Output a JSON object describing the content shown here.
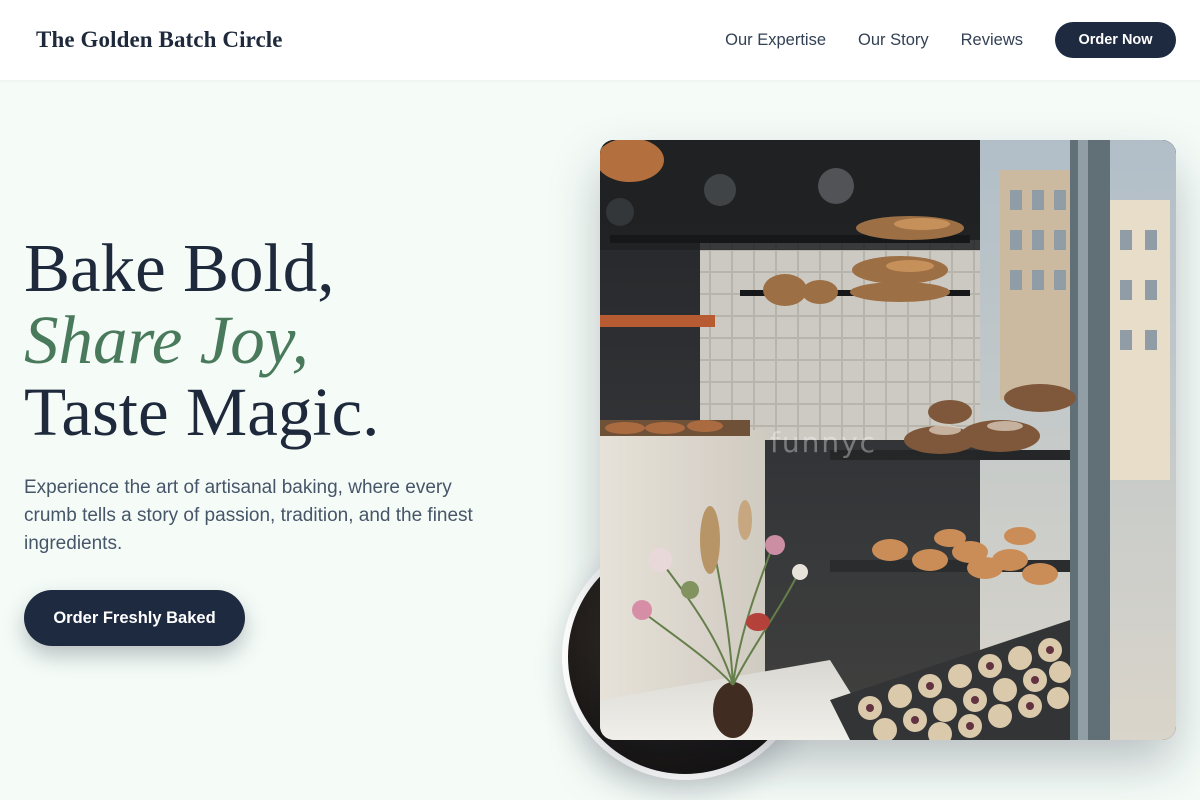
{
  "header": {
    "brand": "The Golden Batch Circle",
    "nav": [
      {
        "label": "Our Expertise"
      },
      {
        "label": "Our Story"
      },
      {
        "label": "Reviews"
      }
    ],
    "order_button": "Order Now"
  },
  "hero": {
    "title_line1": "Bake Bold,",
    "title_line2": "Share Joy,",
    "title_line3": "Taste Magic.",
    "description": "Experience the art of artisanal baking, where every crumb tells a story of passion, tradition, and the finest ingredients.",
    "cta_label": "Order Freshly Baked",
    "image_watermark": "funnyc"
  },
  "colors": {
    "primary": "#1e2a3f",
    "accent_green": "#4a7a5c",
    "background": "#f5fcf8"
  }
}
